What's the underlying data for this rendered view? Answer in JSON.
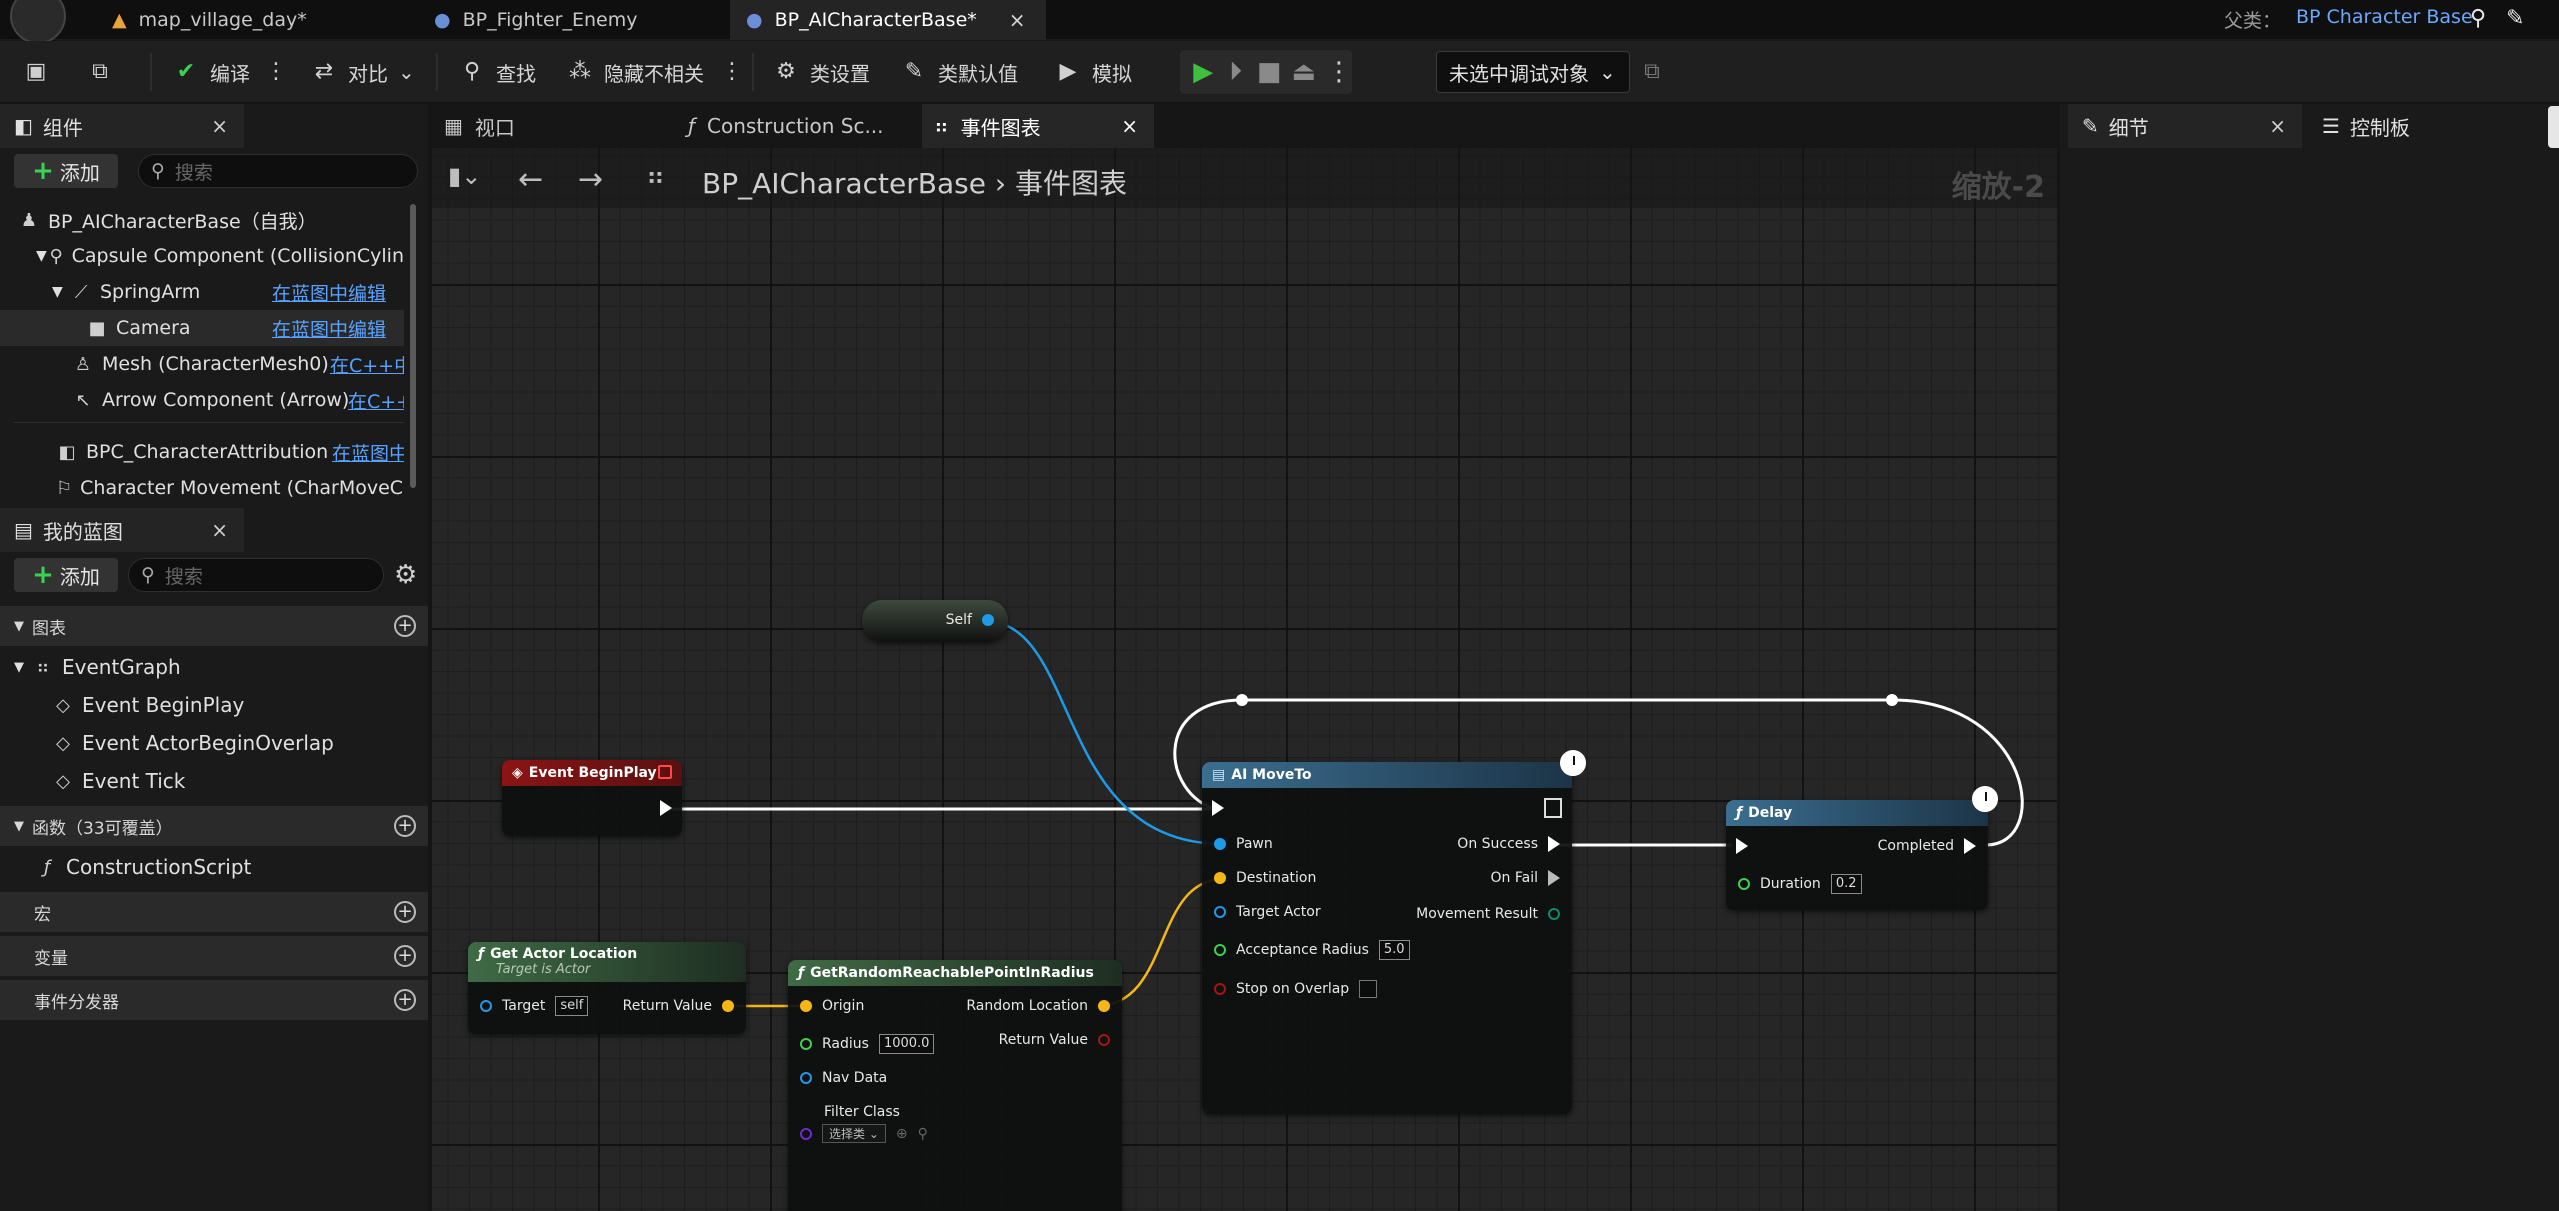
{
  "tabs": [
    {
      "label": "map_village_day*"
    },
    {
      "label": "BP_Fighter_Enemy"
    },
    {
      "label": "BP_AICharacterBase*"
    }
  ],
  "parent": {
    "label": "父类：",
    "value": "BP Character Base"
  },
  "toolbar": {
    "compile": "编译",
    "diff": "对比",
    "find": "查找",
    "hide_unrelated": "隐藏不相关",
    "class_settings": "类设置",
    "class_defaults": "类默认值",
    "simulate": "模拟",
    "debug_target": "未选中调试对象"
  },
  "components_panel": {
    "title": "组件",
    "add": "添加",
    "search_placeholder": "搜索",
    "items": [
      {
        "label": "BP_AICharacterBase（自我）",
        "link": ""
      },
      {
        "label": "Capsule Component (CollisionCylin",
        "link": ""
      },
      {
        "label": "SpringArm",
        "link": "在蓝图中编辑"
      },
      {
        "label": "Camera",
        "link": "在蓝图中编辑"
      },
      {
        "label": "Mesh (CharacterMesh0)",
        "link": "在C++中"
      },
      {
        "label": "Arrow Component (Arrow)",
        "link": "在C++"
      },
      {
        "label": "BPC_CharacterAttribution",
        "link": "在蓝图中"
      },
      {
        "label": "Character Movement (CharMoveCo",
        "link": ""
      }
    ]
  },
  "my_blueprint": {
    "title": "我的蓝图",
    "add": "添加",
    "search_placeholder": "搜索",
    "graphs_header": "图表",
    "event_graph": "EventGraph",
    "events": [
      "Event BeginPlay",
      "Event ActorBeginOverlap",
      "Event Tick"
    ],
    "functions_header": "函数（33可覆盖）",
    "construction_script": "ConstructionScript",
    "macros_header": "宏",
    "variables_header": "变量",
    "dispatchers_header": "事件分发器"
  },
  "graph": {
    "tabs": [
      "视口",
      "Construction Sc...",
      "事件图表"
    ],
    "breadcrumb_root": "BP_AICharacterBase",
    "breadcrumb_sep": "›",
    "breadcrumb_leaf": "事件图表",
    "zoom": "缩放-2"
  },
  "nodes": {
    "self": {
      "label": "Self"
    },
    "begin_play": {
      "title": "Event BeginPlay"
    },
    "ai_move_to": {
      "title": "AI MoveTo",
      "pawn": "Pawn",
      "destination": "Destination",
      "target_actor": "Target Actor",
      "acceptance_radius": "Acceptance Radius",
      "acceptance_radius_value": "5.0",
      "stop_on_overlap": "Stop on Overlap",
      "on_success": "On Success",
      "on_fail": "On Fail",
      "movement_result": "Movement Result"
    },
    "delay": {
      "title": "Delay",
      "completed": "Completed",
      "duration": "Duration",
      "duration_value": "0.2"
    },
    "get_actor_location": {
      "title": "Get Actor Location",
      "subtitle": "Target is Actor",
      "target": "Target",
      "target_value": "self",
      "return_value": "Return Value"
    },
    "get_random_point": {
      "title": "GetRandomReachablePointInRadius",
      "origin": "Origin",
      "radius": "Radius",
      "radius_value": "1000.0",
      "nav_data": "Nav Data",
      "filter_class": "Filter Class",
      "filter_select": "选择类",
      "random_location": "Random Location",
      "return_value": "Return Value"
    }
  },
  "right_panel": {
    "details": "细节",
    "console": "控制板"
  },
  "colors": {
    "exec": "#ffffff",
    "object_pin": "#1e9be8",
    "vector_pin": "#f5b716",
    "float_pin": "#3ad14c",
    "bool_pin": "#a51515",
    "event_header": "#8c1414",
    "function_header": "#2e4f66",
    "pure_header": "#2d4a2d",
    "accent_link": "#5aa2ff"
  }
}
